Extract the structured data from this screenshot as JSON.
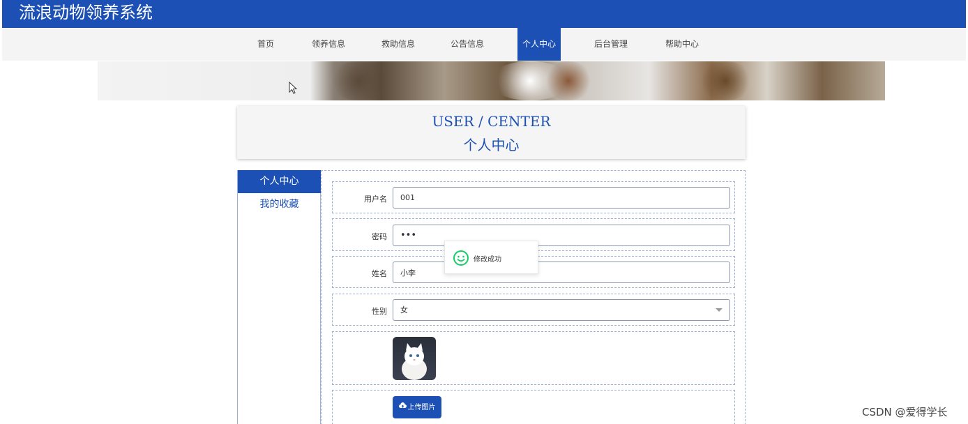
{
  "header": {
    "title": "流浪动物领养系统"
  },
  "nav": {
    "items": [
      {
        "label": "首页"
      },
      {
        "label": "领养信息"
      },
      {
        "label": "救助信息"
      },
      {
        "label": "公告信息"
      },
      {
        "label": "个人中心"
      },
      {
        "label": "后台管理"
      },
      {
        "label": "帮助中心"
      }
    ],
    "active_index": 4
  },
  "user_center": {
    "title_en": "USER / CENTER",
    "title_zh": "个人中心"
  },
  "side_menu": {
    "items": [
      {
        "label": "个人中心"
      },
      {
        "label": "我的收藏"
      }
    ],
    "active_index": 0
  },
  "form": {
    "username": {
      "label": "用户名",
      "value": "001"
    },
    "password": {
      "label": "密码",
      "value": "•••"
    },
    "name": {
      "label": "姓名",
      "value": "小李"
    },
    "gender": {
      "label": "性别",
      "value": "女"
    },
    "upload_label": "上传图片"
  },
  "toast": {
    "message": "修改成功"
  },
  "watermark": "CSDN @爱得学长",
  "colors": {
    "primary": "#1c50b4",
    "success": "#13ce66"
  }
}
